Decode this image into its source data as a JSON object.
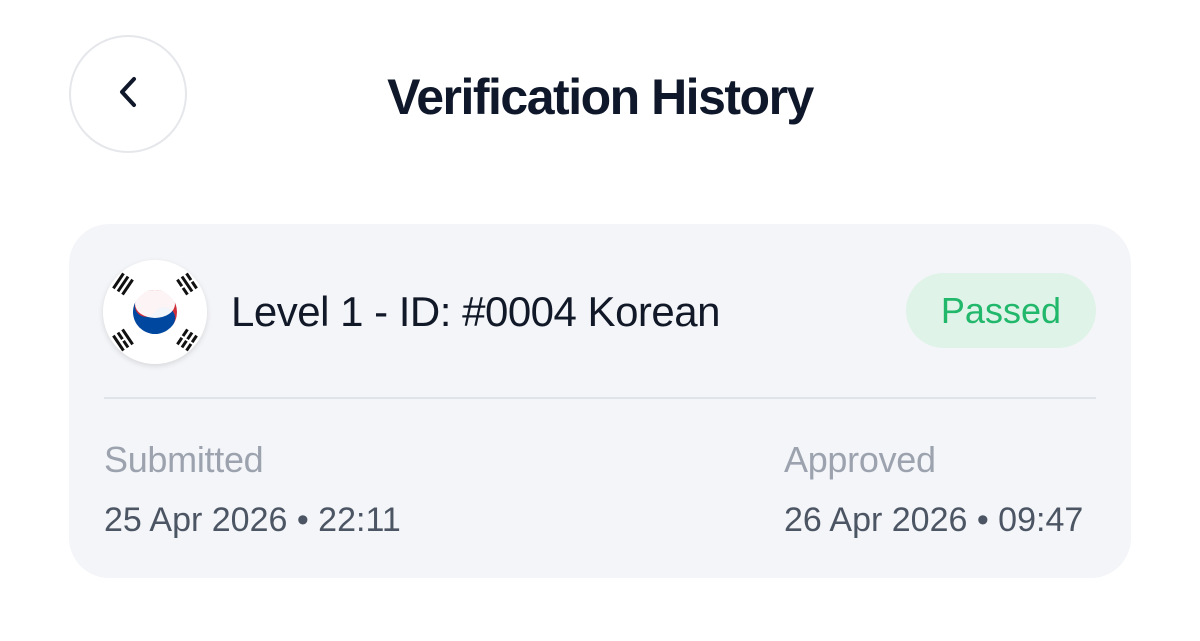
{
  "header": {
    "title": "Verification History",
    "back_icon": "chevron-left-icon"
  },
  "verification": {
    "flag_icon": "south-korea-flag-icon",
    "title": "Level 1 - ID: #0004 Korean",
    "status": "Passed",
    "status_color": "#22b86b",
    "status_bg": "#dff3e8",
    "submitted_label": "Submitted",
    "submitted_value": "25 Apr 2026 • 22:11",
    "approved_label": "Approved",
    "approved_value": "26 Apr 2026 • 09:47"
  },
  "colors": {
    "card_bg": "#f4f5f8",
    "title": "#0f172a",
    "muted": "#9ca3af",
    "value": "#4b5563"
  }
}
